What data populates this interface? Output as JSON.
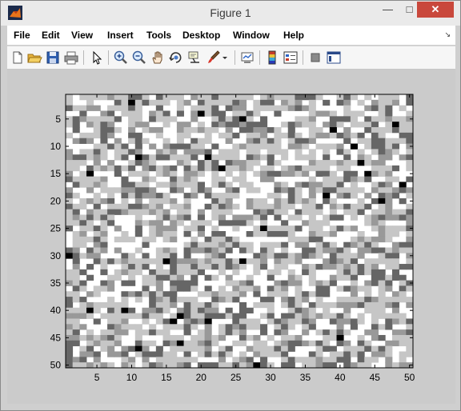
{
  "window": {
    "title": "Figure 1",
    "controls": {
      "minimize": "—",
      "maximize": "□",
      "close": "✕"
    }
  },
  "menu": {
    "items": [
      "File",
      "Edit",
      "View",
      "Insert",
      "Tools",
      "Desktop",
      "Window",
      "Help"
    ],
    "dock_arrow": "↘"
  },
  "toolbar": {
    "icons": [
      "new-figure-icon",
      "open-file-icon",
      "save-icon",
      "print-icon",
      "edit-plot-arrow-icon",
      "zoom-in-icon",
      "zoom-out-icon",
      "pan-hand-icon",
      "rotate-3d-icon",
      "data-cursor-icon",
      "brush-icon",
      "brush-dropdown-icon",
      "link-plot-icon",
      "insert-colorbar-icon",
      "insert-legend-icon",
      "hide-plot-tools-icon",
      "show-plot-tools-icon"
    ]
  },
  "chart_data": {
    "type": "heatmap",
    "rows": 50,
    "cols": 50,
    "colormap": "gray",
    "value_levels": 5,
    "xlim": [
      0.5,
      50.5
    ],
    "ylim": [
      0.5,
      50.5
    ],
    "y_direction": "reverse",
    "x_ticks": [
      5,
      10,
      15,
      20,
      25,
      30,
      35,
      40,
      45,
      50
    ],
    "y_ticks": [
      5,
      10,
      15,
      20,
      25,
      30,
      35,
      40,
      45,
      50
    ],
    "x_tick_labels": [
      "5",
      "10",
      "15",
      "20",
      "25",
      "30",
      "35",
      "40",
      "45",
      "50"
    ],
    "y_tick_labels": [
      "5",
      "10",
      "15",
      "20",
      "25",
      "30",
      "35",
      "40",
      "45",
      "50"
    ],
    "cells_note": "",
    "colors": {
      "level_0": "#000000",
      "level_1": "#666666",
      "level_2": "#999999",
      "level_3": "#c6c6c6",
      "level_4": "#ffffff"
    }
  }
}
